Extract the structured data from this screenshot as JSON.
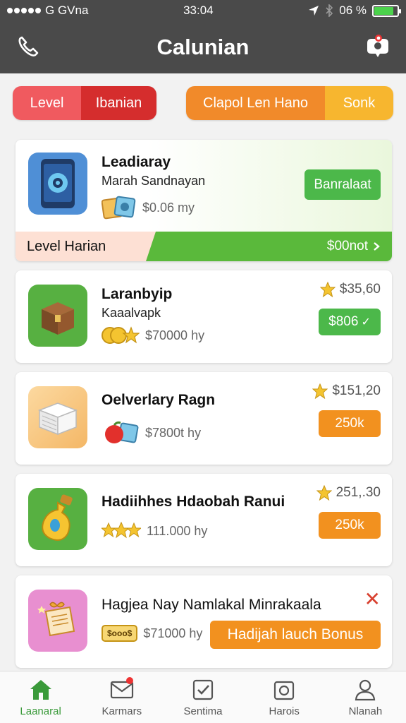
{
  "status_bar": {
    "carrier": "G GVna",
    "time": "33:04",
    "battery_text": "06 %",
    "battery_level": 0.85
  },
  "header": {
    "title": "Calunian"
  },
  "filters": {
    "level": "Level",
    "harian": "Ibanian",
    "global": "Clapol Len Hano",
    "sort": "Sonk"
  },
  "featured": {
    "title": "Leadiaray",
    "subtitle": "Marah Sandnayan",
    "reward": "$0.06 my",
    "button": "Banralaat",
    "level_label": "Level Harian",
    "level_value": "$00not",
    "accent_color": "#5ab93b"
  },
  "cards": [
    {
      "title": "Laranbyip",
      "subtitle": "Kaaalvapk",
      "reward": "$70000 hy",
      "price": "$35,60",
      "button": "$806",
      "button_check": "✓"
    },
    {
      "title": "Oelverlary Ragn",
      "reward": "$7800t hy",
      "price": "$151,20",
      "button": "250k"
    },
    {
      "title": "Hadiihhes Hdaobah Ranui",
      "reward": "111.000 hy",
      "price": "251,.30",
      "button": "250k"
    },
    {
      "title": "Hagjea Nay Namlakal Minrakaala",
      "reward": "$71000 hy",
      "tag": "$ooo$",
      "button": "Hadijah lauch Bonus"
    }
  ],
  "bottom_nav": [
    {
      "label": "Laanaral",
      "icon": "home-icon",
      "active": true
    },
    {
      "label": "Karmars",
      "icon": "mail-icon"
    },
    {
      "label": "Sentima",
      "icon": "checkbox-icon"
    },
    {
      "label": "Harois",
      "icon": "camera-icon"
    },
    {
      "label": "Nlanah",
      "icon": "user-icon"
    }
  ]
}
